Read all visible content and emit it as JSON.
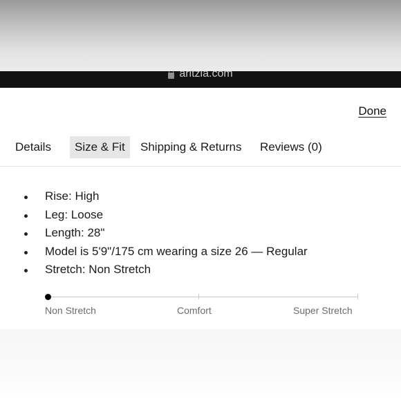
{
  "browser": {
    "url": "aritzia.com",
    "lock_icon": "lock-icon"
  },
  "header": {
    "done_label": "Done"
  },
  "tabs": [
    {
      "label": "Details",
      "active": false
    },
    {
      "label": "Size & Fit",
      "active": true
    },
    {
      "label": "Shipping & Returns",
      "active": false
    },
    {
      "label": "Reviews (0)",
      "active": false
    }
  ],
  "specs": [
    "Rise: High",
    "Leg: Loose",
    "Length: 28\"",
    "Model is 5'9\"/175 cm wearing a size 26  —  Regular",
    "Stretch: Non Stretch"
  ],
  "stretch_scale": {
    "labels": [
      "Non Stretch",
      "Comfort",
      "Super Stretch"
    ],
    "selected": "Non Stretch",
    "level": 0
  }
}
